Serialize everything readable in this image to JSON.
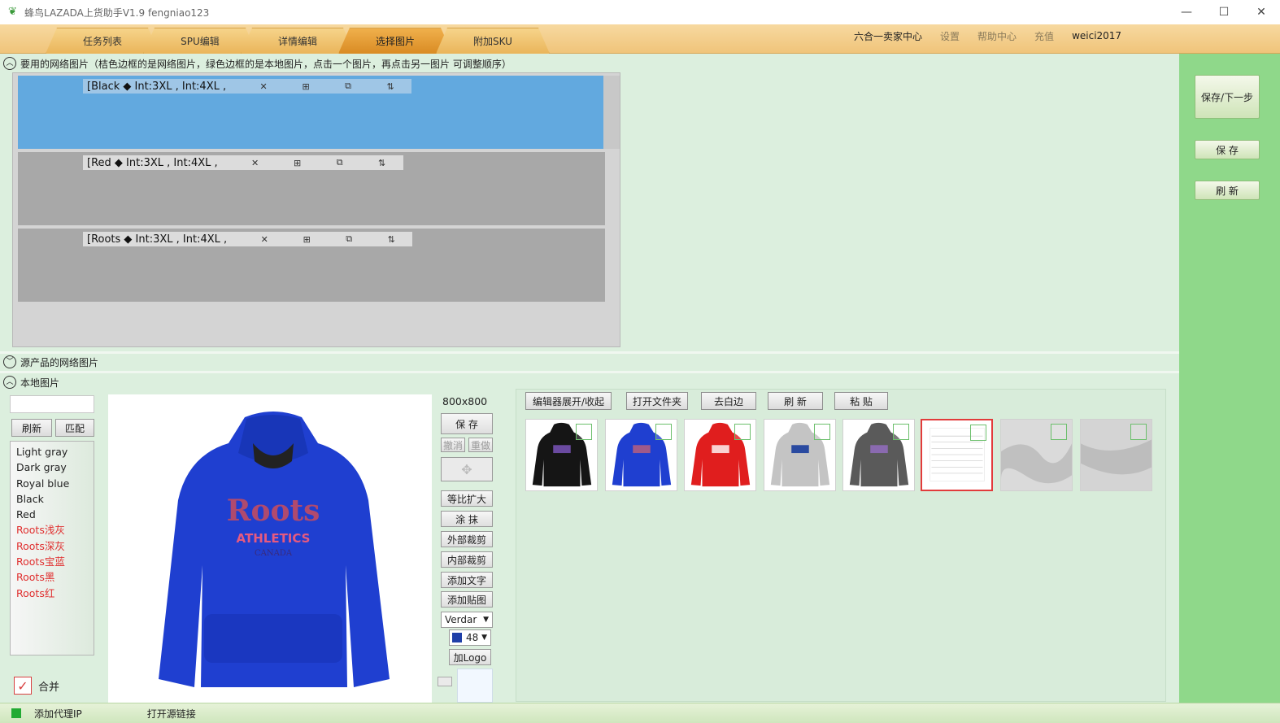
{
  "window": {
    "title": "蜂鸟LAZADA上货助手V1.9  fengniao123",
    "minimize": "—",
    "maximize": "☐",
    "close": "✕"
  },
  "tabs": [
    {
      "label": "任务列表",
      "active": false
    },
    {
      "label": "SPU编辑",
      "active": false
    },
    {
      "label": "详情编辑",
      "active": false
    },
    {
      "label": "选择图片",
      "active": true
    },
    {
      "label": "附加SKU",
      "active": false
    }
  ],
  "toplinks": {
    "seller_center": "六合一卖家中心",
    "settings": "设置",
    "help": "帮助中心",
    "recharge": "充值",
    "user": "weici2017"
  },
  "sections": {
    "network": "要用的网络图片（桔色边框的是网络图片，绿色边框的是本地图片，点击一个图片，再点击另一图片 可调整顺序）",
    "source": "源产品的网络图片",
    "local": "本地图片"
  },
  "network_rows": [
    {
      "label": "[Black ◆ Int:3XL , Int:4XL ,",
      "selected": true
    },
    {
      "label": "[Red ◆ Int:3XL , Int:4XL ,",
      "selected": false
    },
    {
      "label": "[Roots ◆ Int:3XL , Int:4XL ,",
      "selected": false
    }
  ],
  "row_icons": {
    "delete": "✕",
    "grid": "⊞",
    "copy": "⧉",
    "sort": "⇅"
  },
  "local": {
    "search_value": "",
    "refresh_label": "刷新",
    "match_label": "匹配",
    "color_list": [
      {
        "label": "Light gray",
        "red": false
      },
      {
        "label": "Dark gray",
        "red": false
      },
      {
        "label": "Royal blue",
        "red": false
      },
      {
        "label": "Black",
        "red": false
      },
      {
        "label": "Red",
        "red": false
      },
      {
        "label": "Roots浅灰",
        "red": true
      },
      {
        "label": "Roots深灰",
        "red": true
      },
      {
        "label": "Roots宝蓝",
        "red": true
      },
      {
        "label": "Roots黑",
        "red": true
      },
      {
        "label": "Roots红",
        "red": true
      }
    ],
    "merge_label": "合并",
    "merge_checked": true
  },
  "tools": {
    "size": "800x800",
    "save": "保 存",
    "undo": "撤消",
    "redo": "重做",
    "scale": "等比扩大",
    "smear": "涂 抹",
    "outer_crop": "外部裁剪",
    "inner_crop": "内部裁剪",
    "add_text": "添加文字",
    "add_sticker": "添加贴图",
    "font": "Verdar",
    "font_size": "48",
    "add_logo": "加Logo"
  },
  "gallery": {
    "expand": "编辑器展开/收起",
    "open_folder": "打开文件夹",
    "trim": "去白边",
    "refresh": "刷 新",
    "paste": "粘 贴",
    "thumbnails": [
      {
        "name": "black-hoodie",
        "color": "#151515"
      },
      {
        "name": "blue-hoodie",
        "color": "#1f3fd0"
      },
      {
        "name": "red-hoodie",
        "color": "#e01e1e"
      },
      {
        "name": "lightgray-hoodie",
        "color": "#c4c4c4"
      },
      {
        "name": "darkgray-hoodie",
        "color": "#5a5a5a"
      },
      {
        "name": "size-chart",
        "color": "#ffffff",
        "selected": true
      },
      {
        "name": "fabric-1",
        "color": "#d2d2d2"
      },
      {
        "name": "fabric-2",
        "color": "#c9c9c9"
      }
    ]
  },
  "preview": {
    "logo_line1": "Roots",
    "logo_line2": "ATHLETICS",
    "logo_line3": "CANADA"
  },
  "right": {
    "save_next": "保存/下一步",
    "save": "保 存",
    "refresh": "刷 新"
  },
  "status": {
    "proxy": "添加代理IP",
    "open_link": "打开源链接"
  }
}
